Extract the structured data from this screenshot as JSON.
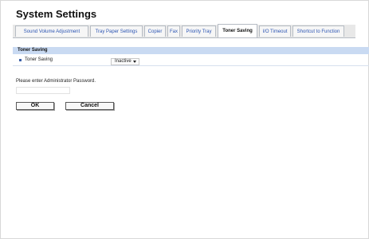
{
  "page": {
    "title": "System Settings"
  },
  "tabs": [
    {
      "label": "Sound Volume Adjustment",
      "active": false
    },
    {
      "label": "Tray Paper Settings",
      "active": false
    },
    {
      "label": "Copier",
      "active": false
    },
    {
      "label": "Fax",
      "active": false
    },
    {
      "label": "Priority Tray",
      "active": false
    },
    {
      "label": "Toner Saving",
      "active": true
    },
    {
      "label": "I/O Timeout",
      "active": false
    },
    {
      "label": "Shortcut to Function",
      "active": false
    }
  ],
  "section": {
    "title": "Toner Saving",
    "setting": {
      "label": "Toner Saving",
      "value": "Inactive"
    }
  },
  "password": {
    "prompt": "Please enter Administrator Password.",
    "value": ""
  },
  "buttons": {
    "ok": "OK",
    "cancel": "Cancel"
  },
  "colors": {
    "tab_link": "#2d56b3",
    "section_header_bg": "#c9daf2",
    "tab_bar_bg": "#e8e8e8"
  },
  "icons": {
    "setting_bullet": "square-bullet-icon",
    "select_arrow": "caret-down-icon"
  }
}
